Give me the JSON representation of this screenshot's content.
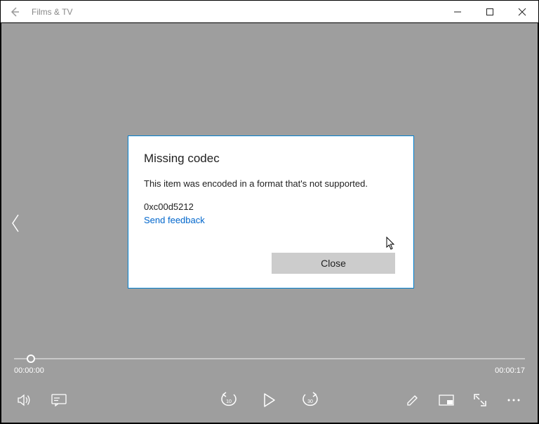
{
  "titlebar": {
    "app_title": "Films & TV"
  },
  "dialog": {
    "title": "Missing codec",
    "message": "This item was encoded in a format that's not supported.",
    "error_code": "0xc00d5212",
    "feedback_link": "Send feedback",
    "close_label": "Close"
  },
  "player": {
    "current_time": "00:00:00",
    "total_time": "00:00:17",
    "skip_back_label": "10",
    "skip_fwd_label": "30"
  }
}
